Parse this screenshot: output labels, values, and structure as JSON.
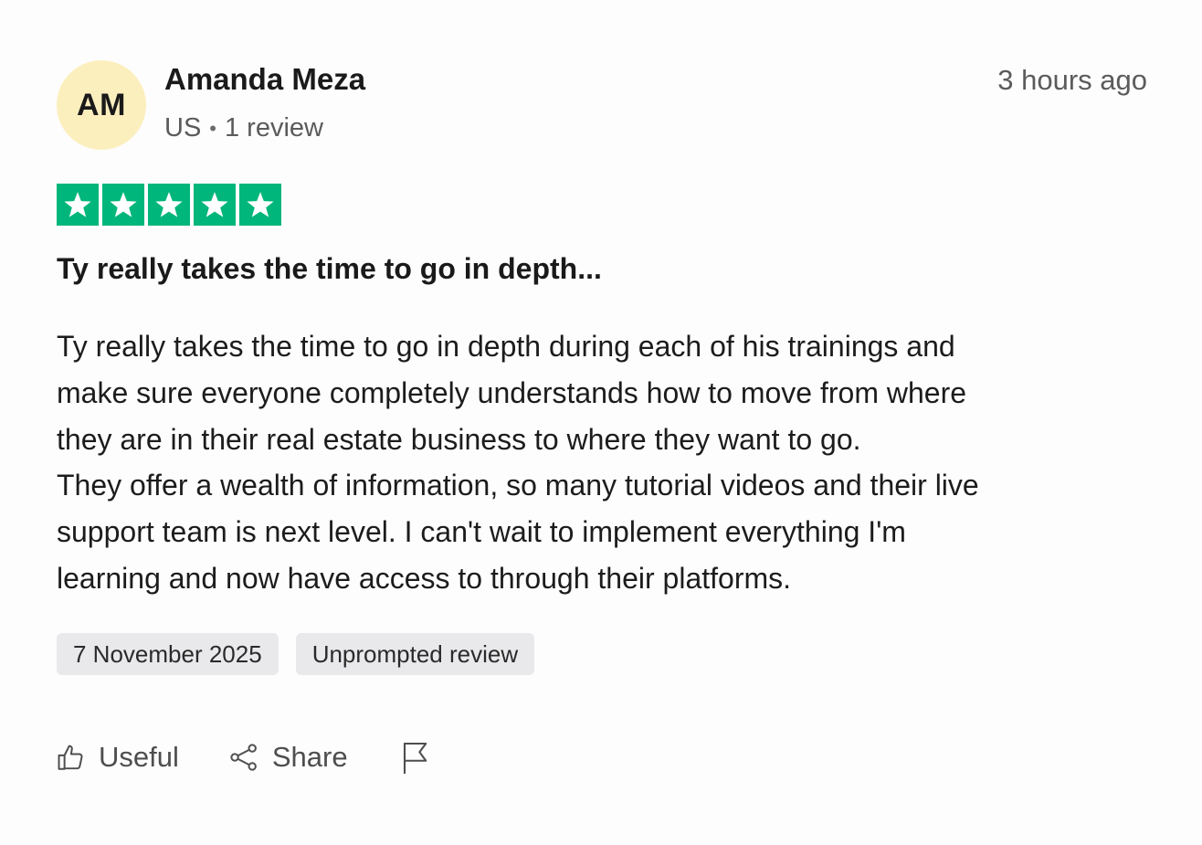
{
  "author": {
    "initials": "AM",
    "name": "Amanda Meza",
    "country": "US",
    "separator": "•",
    "review_count": "1 review",
    "avatar_color": "#fcefbe"
  },
  "time_ago": "3 hours ago",
  "rating": {
    "stars": 5,
    "max": 5,
    "star_color": "#00b67a"
  },
  "review": {
    "title": "Ty really takes the time to go in depth...",
    "lines": [
      "Ty really takes the time to go in depth during each of his trainings and",
      "make sure everyone completely understands how to move from where",
      "they are in their real estate business to where they want to go.",
      "They offer a wealth of information, so many tutorial videos and their live",
      "support team is next level. I can't wait to implement everything I'm",
      "learning and now have access to through their platforms."
    ]
  },
  "tags": {
    "date": "7 November 2025",
    "type": "Unprompted review"
  },
  "actions": {
    "useful_label": "Useful",
    "share_label": "Share",
    "useful_icon": "thumbs-up-icon",
    "share_icon": "share-icon",
    "report_icon": "flag-icon"
  }
}
